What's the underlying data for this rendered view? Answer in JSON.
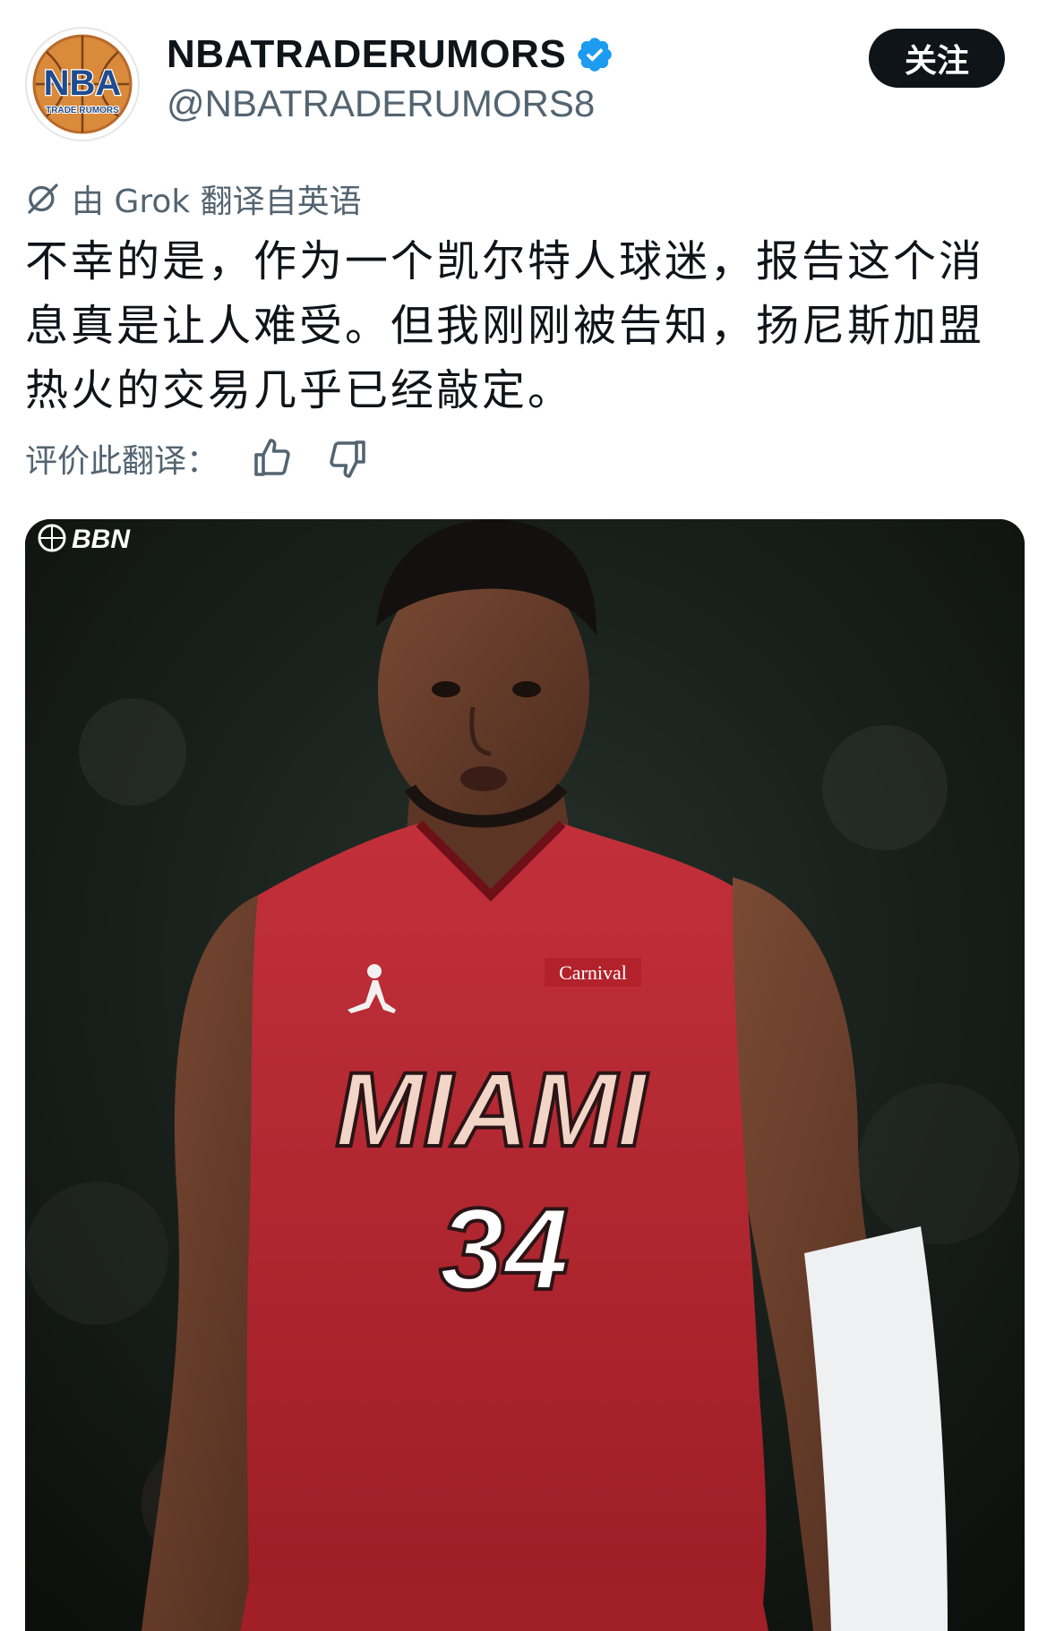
{
  "header": {
    "display_name": "NBATRADERUMORS",
    "handle": "@NBATRADERUMORS8",
    "follow_label": "关注",
    "avatar_logo": {
      "title": "NBA",
      "subtitle": "TRADE RUMORS"
    }
  },
  "translation": {
    "note": "由 Grok 翻译自英语",
    "rate_label": "评价此翻译："
  },
  "tweet": {
    "text": "不幸的是，作为一个凯尔特人球迷，报告这个消息真是让人难受。但我刚刚被告知，扬尼斯加盟热火的交易几乎已经敲定。"
  },
  "media": {
    "watermark": "BBN",
    "jersey": {
      "team": "MIAMI",
      "number": "34",
      "sponsor": "Carnival"
    }
  },
  "icons": {
    "verified": "verified-badge-icon",
    "grok": "grok-icon",
    "thumbs_up": "thumbs-up-icon",
    "thumbs_down": "thumbs-down-icon"
  },
  "colors": {
    "verified": "#1d9bf0",
    "follow_bg": "#0f1419",
    "muted_text": "#536471",
    "jersey_red": "#b3222b"
  }
}
